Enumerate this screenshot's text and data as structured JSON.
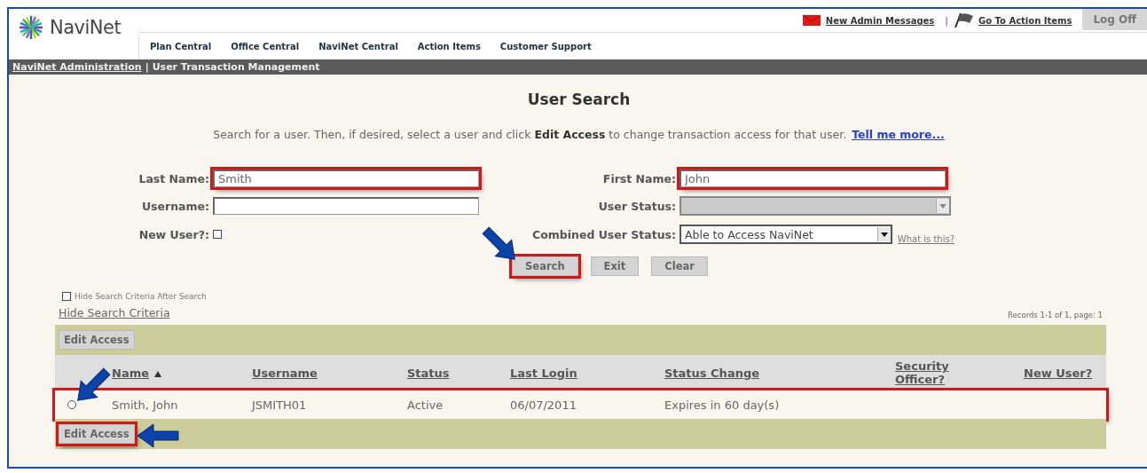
{
  "header": {
    "logo": "NaviNet",
    "links": [
      {
        "label": "New Admin Messages",
        "kind": "mail"
      },
      {
        "label": "Go To Action Items",
        "kind": "flag"
      }
    ],
    "separator": "|",
    "logoff": "Log Off",
    "nav": [
      "Plan Central",
      "Office Central",
      "NaviNet Central",
      "Action Items",
      "Customer Support"
    ]
  },
  "breadcrumb": {
    "link": "NaviNet Administration",
    "separator": "|",
    "current": "User Transaction Management"
  },
  "title": "User Search",
  "intro": "Search for a user. Then, if desired, select a user and click **Edit Access** to change transaction access for that user.",
  "intro_link": "Tell me more...",
  "fields": [
    {
      "kind": "text",
      "label": "Last Name:",
      "value": "Smith",
      "highlighted": true
    },
    {
      "kind": "text",
      "label": "First Name:",
      "value": "John",
      "highlighted": true
    },
    {
      "kind": "text",
      "label": "Username:",
      "highlighted": false
    },
    {
      "kind": "select",
      "label": "User Status:",
      "disabled": true,
      "highlighted": false
    },
    {
      "kind": "checkbox",
      "label": "New User?:",
      "checked": false
    },
    {
      "kind": "select",
      "label": "Combined User Status:",
      "value": "Able to Access NaviNet",
      "disabled": false,
      "highlighted": false,
      "help_link": "What is this?"
    }
  ],
  "buttons": [
    {
      "label": "Search",
      "highlighted": true
    },
    {
      "label": "Exit",
      "highlighted": false
    },
    {
      "label": "Clear",
      "highlighted": false
    }
  ],
  "hide_after_search": {
    "label": "Hide Search Criteria After Search",
    "checked": false
  },
  "hide_link": "Hide Search Criteria",
  "records": "Records 1-1 of 1, page:  1",
  "table": {
    "top_button": {
      "label": "Edit Access",
      "highlighted": false
    },
    "columns": [
      {
        "label": "Name",
        "sorted": true
      },
      {
        "label": "Username",
        "sorted": false
      },
      {
        "label": "Status",
        "sorted": false
      },
      {
        "label": "Last Login",
        "sorted": false
      },
      {
        "label": "Status Change",
        "sorted": false
      },
      {
        "label": "Security Officer?",
        "sorted": false
      },
      {
        "label": "New User?",
        "sorted": false
      }
    ],
    "rows": [
      {
        "selected": false,
        "highlighted": true,
        "cells": [
          "Smith, John",
          "JSMITH01",
          "Active",
          "06/07/2011",
          "Expires in 60 day(s)"
        ]
      }
    ],
    "bottom_button": {
      "label": "Edit Access",
      "highlighted": true
    }
  }
}
